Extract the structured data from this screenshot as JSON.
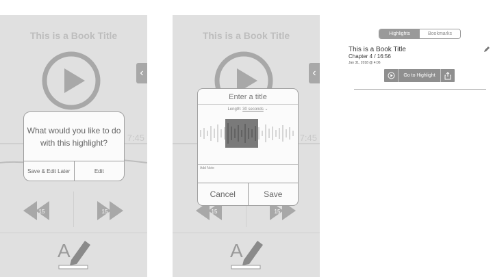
{
  "player": {
    "book_title": "This is a Book Title",
    "time_remaining_partial": "7:45",
    "rewind_label": "15",
    "forward_label": "15"
  },
  "highlight_dialog": {
    "question": "What would you like to do with this highlight?",
    "save_edit_later": "Save & Edit Later",
    "edit": "Edit"
  },
  "title_dialog": {
    "placeholder": "Enter a title",
    "length_prefix": "Length:",
    "length_value": "30 seconds",
    "add_note": "Add Note",
    "cancel": "Cancel",
    "save": "Save"
  },
  "highlights_list": {
    "tabs": [
      "Highlights",
      "Bookmarks"
    ],
    "active_tab": "Highlights",
    "item": {
      "title": "This is a Book Title",
      "chapter": "Chapter 4 / 16:56",
      "date": "Jan 31, 2018 @ 4:06",
      "go_to": "Go to Highlight"
    }
  },
  "icons": [
    "play-icon",
    "chevron-left-icon",
    "rewind-15-icon",
    "forward-15-icon",
    "highlight-pen-icon",
    "pencil-icon",
    "play-circle-icon",
    "share-icon",
    "chevron-down-icon"
  ],
  "colors": {
    "wireframe_bg": "#e0e0e0",
    "wireframe_shape": "#a8a8a8",
    "dialog_bg": "#fbfbfb"
  }
}
